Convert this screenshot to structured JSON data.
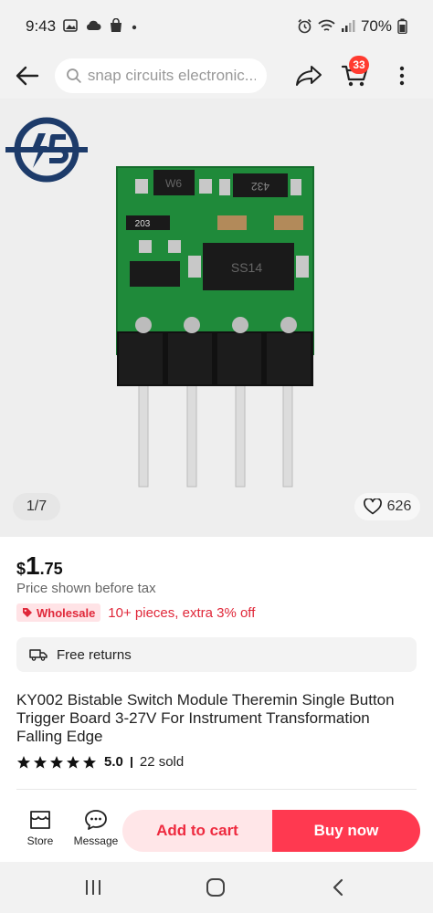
{
  "status_bar": {
    "time": "9:43",
    "battery": "70%",
    "icons": [
      "image-icon",
      "cloud-icon",
      "shopping-bag-icon",
      "dot-icon",
      "alarm-icon",
      "wifi-icon",
      "signal-icon",
      "battery-icon"
    ]
  },
  "header": {
    "search_placeholder": "snap circuits electronic...",
    "cart_count": "33"
  },
  "gallery": {
    "page_indicator": "1/7",
    "wishlist_count": "626",
    "image_labels": {
      "ic_top_left": "W6",
      "ic_top_right": "432",
      "resistor": "203",
      "chip": "SS14"
    }
  },
  "product": {
    "currency": "$",
    "price_int": "1",
    "price_dec": ".75",
    "price_note": "Price shown before tax",
    "wholesale_badge": "Wholesale",
    "wholesale_text": "10+ pieces, extra 3% off",
    "returns": "Free returns",
    "title": "KY002 Bistable Switch Module Theremin Single Button Trigger Board 3-27V For Instrument Transformation Falling Edge",
    "rating": "5.0",
    "rating_stars": 5,
    "sold": "22 sold"
  },
  "action_bar": {
    "store_label": "Store",
    "message_label": "Message",
    "add_to_cart": "Add to cart",
    "buy_now": "Buy now"
  },
  "colors": {
    "accent": "#ff3950",
    "accent_light": "#ffe6e8",
    "badge": "#ff3b30",
    "pcb": "#1f8a3a",
    "logo_blue": "#1d3b6a"
  }
}
